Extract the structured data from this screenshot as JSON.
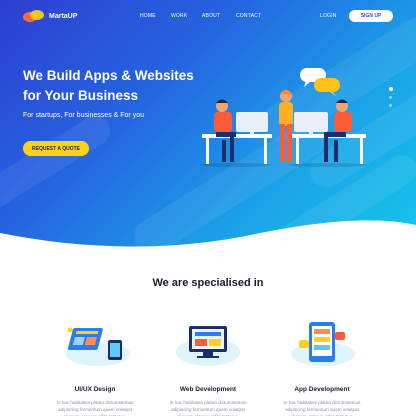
{
  "brand": {
    "name": "MartaUP"
  },
  "nav": {
    "items": [
      {
        "label": "HOME"
      },
      {
        "label": "WORK"
      },
      {
        "label": "ABOUT"
      },
      {
        "label": "CONTACT"
      }
    ],
    "login_label": "LOGIN",
    "signup_label": "SIGN UP"
  },
  "hero": {
    "title_line1": "We Build Apps & Websites",
    "title_line2": "for Your Business",
    "subtitle": "For startups, For businesses & For you",
    "cta_label": "REQUEST A QUOTE",
    "slide_count": 3,
    "active_slide": 1
  },
  "services": {
    "heading": "We are specialised in",
    "cards": [
      {
        "title": "UI/UX Design",
        "desc": "In hac habitasse platea dictumstemus adipiscing fermentum quam volutpat aliquam. Integer cillits tristique.",
        "icon": "ui-ux-design-icon"
      },
      {
        "title": "Web Development",
        "desc": "In hac habitasse platea dictumstemus adipiscing fermentum quam volutpat aliquam. Integer cillits tristique.",
        "icon": "web-development-icon"
      },
      {
        "title": "App Development",
        "desc": "In hac habitasse platea dictumstemus adipiscing fermentum quam volutpat aliquam. Integer cillits tristique.",
        "icon": "app-development-icon"
      }
    ]
  },
  "colors": {
    "hero_gradient_start": "#2d3fd0",
    "hero_gradient_end": "#14c6ea",
    "accent_yellow": "#ffd21a",
    "primary_blue": "#2a4fd8",
    "heading_dark": "#1a1a2e"
  }
}
